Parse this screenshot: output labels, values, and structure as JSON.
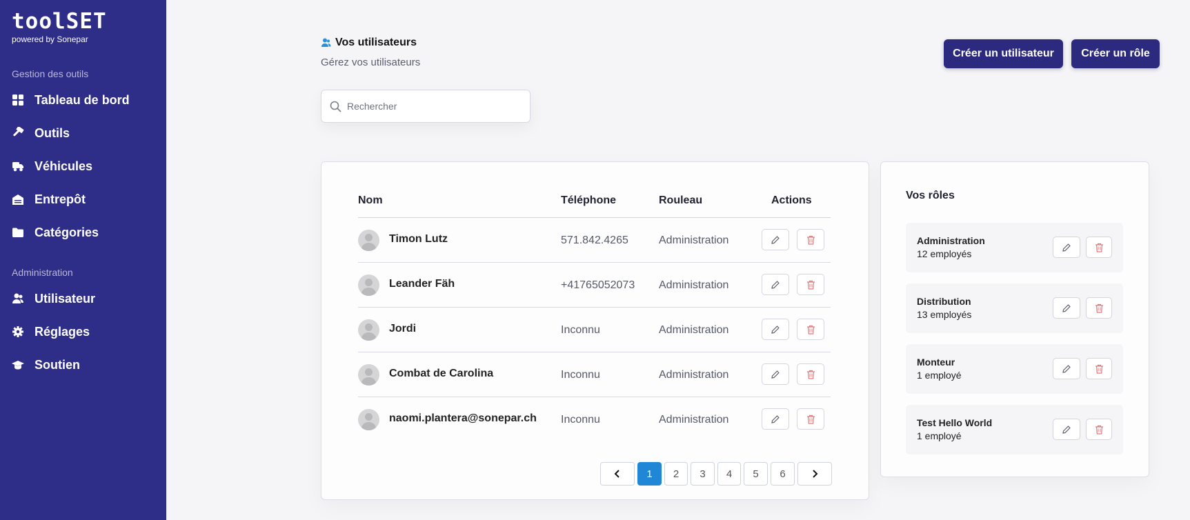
{
  "sidebar": {
    "logo": "toolSET",
    "powered_by": "powered by Sonepar",
    "section_tools": "Gestion des outils",
    "section_admin": "Administration",
    "items": [
      {
        "label": "Tableau de bord",
        "icon": "dashboard-icon"
      },
      {
        "label": "Outils",
        "icon": "hammer-icon"
      },
      {
        "label": "Véhicules",
        "icon": "truck-icon"
      },
      {
        "label": "Entrepôt",
        "icon": "warehouse-icon"
      },
      {
        "label": "Catégories",
        "icon": "folder-icon"
      },
      {
        "label": "Utilisateur",
        "icon": "users-icon"
      },
      {
        "label": "Réglages",
        "icon": "gear-icon"
      },
      {
        "label": "Soutien",
        "icon": "graduation-cap-icon"
      }
    ]
  },
  "header": {
    "title": "Vos utilisateurs",
    "subtitle": "Gérez vos utilisateurs",
    "create_user_label": "Créer un utilisateur",
    "create_role_label": "Créer un rôle"
  },
  "search": {
    "placeholder": "Rechercher",
    "value": ""
  },
  "users_table": {
    "columns": [
      "Nom",
      "Téléphone",
      "Rouleau",
      "Actions"
    ],
    "rows": [
      {
        "name": "Timon Lutz",
        "phone": "571.842.4265",
        "role": "Administration"
      },
      {
        "name": "Leander Fäh",
        "phone": "+41765052073",
        "role": "Administration"
      },
      {
        "name": "Jordi",
        "phone": "Inconnu",
        "role": "Administration"
      },
      {
        "name": "Combat de Carolina",
        "phone": "Inconnu",
        "role": "Administration"
      },
      {
        "name": "naomi.plantera@sonepar.ch",
        "phone": "Inconnu",
        "role": "Administration"
      }
    ]
  },
  "pagination": {
    "pages": [
      "1",
      "2",
      "3",
      "4",
      "5",
      "6"
    ],
    "current": "1"
  },
  "roles": {
    "title": "Vos rôles",
    "items": [
      {
        "name": "Administration",
        "count": "12 employés"
      },
      {
        "name": "Distribution",
        "count": "13 employés"
      },
      {
        "name": "Monteur",
        "count": "1 employé"
      },
      {
        "name": "Test Hello World",
        "count": "1 employé"
      }
    ]
  },
  "colors": {
    "sidebar_bg": "#2e2d87",
    "primary_button": "#2c2a7e",
    "active_page": "#1f87d6",
    "delete_icon": "#e07a7a"
  }
}
